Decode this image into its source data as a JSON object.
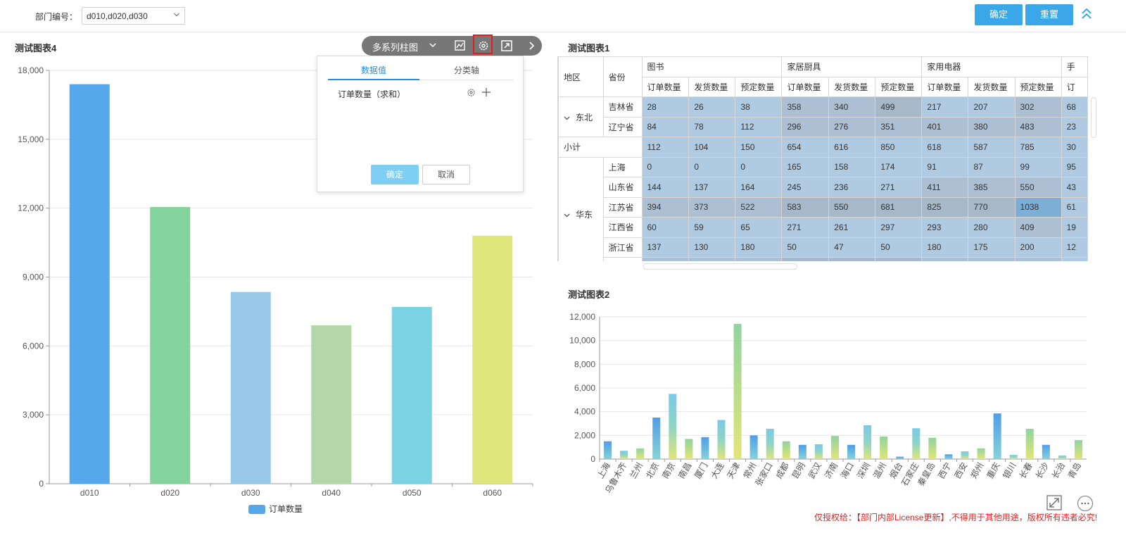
{
  "filter": {
    "label": "部门编号：",
    "value": "d010,d020,d030"
  },
  "header_buttons": {
    "confirm": "确定",
    "reset": "重置"
  },
  "colors": {
    "primary": "#3aa8e8",
    "cell_blue": "#b0cbe1",
    "license_red": "#e02020"
  },
  "chart4": {
    "title": "测试图表4",
    "toolbar": {
      "chart_type": "多系列柱图"
    },
    "popup": {
      "tab_values": "数据值",
      "tab_axis": "分类轴",
      "field": "订单数量（求和）",
      "ok": "确定",
      "cancel": "取消"
    },
    "legend": "订单数量",
    "y_ticks": [
      "0",
      "3,000",
      "6,000",
      "9,000",
      "12,000",
      "15,000",
      "18,000"
    ]
  },
  "chart1": {
    "title": "测试图表1",
    "col_region": "地区",
    "col_province": "省份",
    "groups": [
      "图书",
      "家居厨具",
      "家用电器",
      "手"
    ],
    "measures": [
      "订单数量",
      "发货数量",
      "预定数量",
      "订"
    ],
    "subtotal_label": "小计",
    "regions": [
      {
        "name": "东北",
        "rows": [
          {
            "province": "吉林省",
            "values": [
              "28",
              "26",
              "38",
              "358",
              "340",
              "499",
              "217",
              "207",
              "302",
              "68"
            ]
          },
          {
            "province": "辽宁省",
            "values": [
              "84",
              "78",
              "112",
              "296",
              "276",
              "351",
              "401",
              "380",
              "483",
              "23"
            ]
          }
        ],
        "subtotal": [
          "112",
          "104",
          "150",
          "654",
          "616",
          "850",
          "618",
          "587",
          "785",
          "30"
        ]
      },
      {
        "name": "华东",
        "rows": [
          {
            "province": "上海",
            "values": [
              "0",
              "0",
              "0",
              "165",
              "158",
              "174",
              "91",
              "87",
              "99",
              "95"
            ]
          },
          {
            "province": "山东省",
            "values": [
              "144",
              "137",
              "164",
              "245",
              "236",
              "271",
              "411",
              "385",
              "550",
              "43"
            ]
          },
          {
            "province": "江苏省",
            "values": [
              "394",
              "373",
              "522",
              "583",
              "550",
              "681",
              "825",
              "770",
              "1038",
              "61"
            ]
          },
          {
            "province": "江西省",
            "values": [
              "60",
              "59",
              "65",
              "271",
              "261",
              "297",
              "293",
              "280",
              "409",
              "19"
            ]
          },
          {
            "province": "浙江省",
            "values": [
              "137",
              "130",
              "180",
              "50",
              "47",
              "50",
              "180",
              "175",
              "200",
              "12"
            ]
          }
        ]
      }
    ]
  },
  "chart2": {
    "title": "测试图表2"
  },
  "license": "仅授权给：【部门内部License更新】,不得用于其他用途，版权所有违者必究!",
  "chart_data": [
    {
      "type": "bar",
      "title": "测试图表4",
      "categories": [
        "d010",
        "d020",
        "d030",
        "d040",
        "d050",
        "d060"
      ],
      "series": [
        {
          "name": "订单数量",
          "values": [
            17400,
            12050,
            8350,
            6900,
            7700,
            10800
          ]
        }
      ],
      "bar_colors": [
        "#55a8ec",
        "#84d29c",
        "#98c8e8",
        "#b3d7a6",
        "#7ad2e3",
        "#dfe47b"
      ],
      "ylim": [
        0,
        18000
      ],
      "yticks": [
        0,
        3000,
        6000,
        9000,
        12000,
        15000,
        18000
      ],
      "grid": true,
      "legend": "bottom-center"
    },
    {
      "type": "bar",
      "title": "测试图表2",
      "categories": [
        "上海",
        "乌鲁木齐",
        "兰州",
        "北京",
        "南京",
        "南昌",
        "厦门",
        "大连",
        "天津",
        "常州",
        "张家口",
        "成都",
        "昆明",
        "武汉",
        "济南",
        "海口",
        "深圳",
        "温州",
        "烟台",
        "石家庄",
        "秦皇岛",
        "西宁",
        "西安",
        "郑州",
        "重庆",
        "银川",
        "长春",
        "长沙",
        "长治",
        "青岛"
      ],
      "values": [
        1500,
        700,
        900,
        3500,
        5500,
        1700,
        1850,
        3300,
        11400,
        2000,
        2550,
        1500,
        1200,
        1250,
        1950,
        1200,
        2850,
        1900,
        200,
        2600,
        1800,
        400,
        650,
        900,
        3850,
        350,
        2550,
        1200,
        300,
        1600
      ],
      "ylim": [
        0,
        12000
      ],
      "yticks": [
        0,
        2000,
        4000,
        6000,
        8000,
        10000,
        12000
      ],
      "grid": true
    }
  ]
}
